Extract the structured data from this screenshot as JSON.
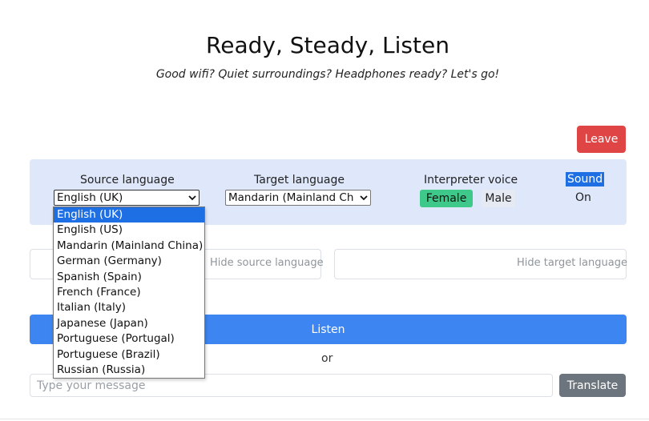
{
  "header": {
    "title": "Ready, Steady, Listen",
    "subtitle": "Good wifi? Quiet surroundings? Headphones ready? Let's go!"
  },
  "actions": {
    "leave_label": "Leave",
    "listen_label": "Listen",
    "or_label": "or",
    "translate_label": "Translate"
  },
  "settings": {
    "source_label": "Source language",
    "source_selected": "English (UK)",
    "target_label": "Target language",
    "target_selected": "Mandarin (Mainland Ch",
    "voice_label": "Interpreter voice",
    "voice_options": [
      "Female",
      "Male"
    ],
    "voice_selected": "Female",
    "sound_label": "Sound",
    "sound_state": "On"
  },
  "panels": {
    "hide_source": "Hide source language",
    "hide_target": "Hide target language"
  },
  "message": {
    "placeholder": "Type your message"
  },
  "source_options": [
    "English (UK)",
    "English (US)",
    "Mandarin (Mainland China)",
    "German (Germany)",
    "Spanish (Spain)",
    "French (France)",
    "Italian (Italy)",
    "Japanese (Japan)",
    "Portuguese (Portugal)",
    "Portuguese (Brazil)",
    "Russian (Russia)"
  ],
  "colors": {
    "leave": "#e04545",
    "listen": "#3d86f2",
    "female_active": "#3ec98a",
    "panel_bg": "#dfe8fb",
    "translate": "#6c757d"
  }
}
